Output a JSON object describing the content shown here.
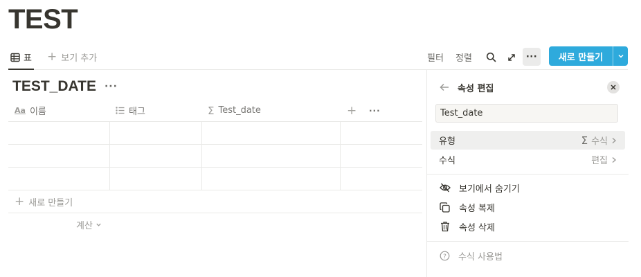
{
  "page": {
    "title": "TEST"
  },
  "views": {
    "active_tab": "표",
    "add_view": "보기 추가"
  },
  "toolbar": {
    "filter": "필터",
    "sort": "정렬",
    "more": "···",
    "new_button": "새로 만들기"
  },
  "database": {
    "title": "TEST_DATE",
    "more": "···",
    "columns": [
      {
        "name": "이름",
        "icon": "Aa"
      },
      {
        "name": "태그",
        "icon": "list-icon"
      },
      {
        "name": "Test_date",
        "icon": "Σ"
      }
    ],
    "rows": [
      {},
      {},
      {}
    ],
    "new_row": "새로 만들기",
    "calculate": "계산"
  },
  "panel": {
    "title": "속성 편집",
    "property_name": "Test_date",
    "type_label": "유형",
    "type_value": "수식",
    "type_icon": "Σ",
    "formula_label": "수식",
    "formula_value": "편집",
    "actions": {
      "hide": "보기에서 숨기기",
      "duplicate": "속성 복제",
      "delete": "속성 삭제"
    },
    "help": "수식 사용법"
  },
  "colors": {
    "accent": "#2eaadc",
    "text": "#37352f",
    "muted": "#9b9a97",
    "border": "#e9e9e7"
  }
}
